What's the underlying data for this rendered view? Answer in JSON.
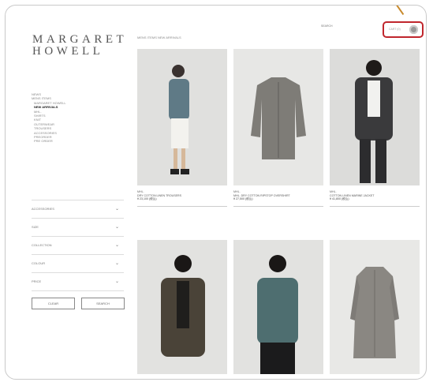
{
  "brand": {
    "line1": "MARGARET",
    "line2": "HOWELL"
  },
  "nav": [
    {
      "label": "NEWS",
      "level": 0,
      "active": false
    },
    {
      "label": "MENS ITEMS",
      "level": 0,
      "active": false
    },
    {
      "label": "MARGARET HOWELL",
      "level": 1,
      "active": false
    },
    {
      "label": "NEW ARRIVALS",
      "level": 1,
      "active": true
    },
    {
      "label": "MHL.",
      "level": 1,
      "active": false
    },
    {
      "label": "SHIRTS",
      "level": 1,
      "active": false
    },
    {
      "label": "KNIT",
      "level": 1,
      "active": false
    },
    {
      "label": "OUTERWEAR",
      "level": 1,
      "active": false
    },
    {
      "label": "TROUSERS",
      "level": 1,
      "active": false
    },
    {
      "label": "ACCESSORIES",
      "level": 1,
      "active": false
    },
    {
      "label": "PREORDER",
      "level": 1,
      "active": false
    },
    {
      "label": "PRE ORDER",
      "level": 1,
      "active": false
    }
  ],
  "filters": [
    {
      "label": "ACCESSORIES"
    },
    {
      "label": "SIZE"
    },
    {
      "label": "COLLECTION"
    },
    {
      "label": "COLOUR"
    },
    {
      "label": "PRICE"
    }
  ],
  "filter_buttons": {
    "clear": "CLEAR",
    "search": "SEARCH"
  },
  "breadcrumb": "MENS ITEMS  NEW ARRIVALS",
  "utility": {
    "search_placeholder": "SEARCH",
    "cart_label": "CART (0)"
  },
  "products": [
    {
      "brand": "MHL.",
      "name": "DRY COTTON LINEN TROUSERS",
      "price": "¥ 23,100 (税込)",
      "image": "model-grey-jacket-white-shorts"
    },
    {
      "brand": "MHL.",
      "name": "MHL. DRY COTTON RIPSTOP OVERSHIRT",
      "price": "¥ 27,500 (税込)",
      "image": "grey-overshirt-flatlay"
    },
    {
      "brand": "MHL.",
      "name": "COTTON LINEN MARINE JACKET",
      "price": "¥ 41,800 (税込)",
      "image": "model-charcoal-jacket"
    },
    {
      "brand": "",
      "name": "",
      "price": "",
      "image": "model-brown-blazer"
    },
    {
      "brand": "",
      "name": "",
      "price": "",
      "image": "model-teal-shirt"
    },
    {
      "brand": "",
      "name": "",
      "price": "",
      "image": "grey-long-coat-flatlay"
    }
  ],
  "colors": {
    "highlight": "#c0262d",
    "callout": "#c88a2c"
  }
}
